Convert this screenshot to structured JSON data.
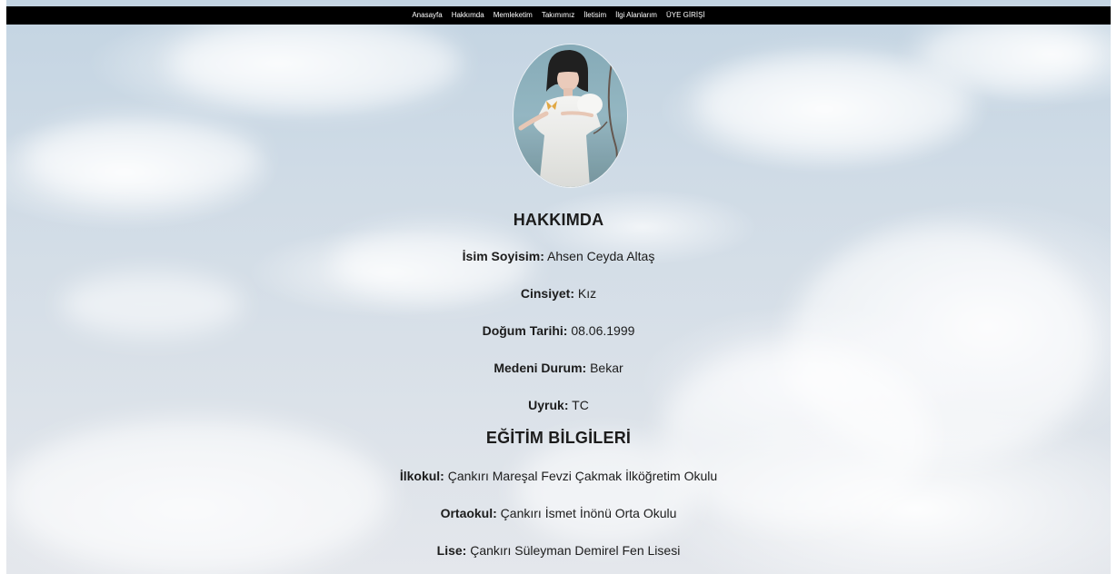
{
  "nav": {
    "items": [
      {
        "label": "Anasayfa"
      },
      {
        "label": "Hakkımda"
      },
      {
        "label": "Memleketim"
      },
      {
        "label": "Takımımız"
      },
      {
        "label": "İletisim"
      },
      {
        "label": "İlgi Alanlarım"
      },
      {
        "label": "ÜYE GİRİŞİ"
      }
    ]
  },
  "profile": {
    "photo_alt": "profile-photo"
  },
  "about": {
    "heading": "HAKKIMDA",
    "rows": [
      {
        "label": "İsim Soyisim:",
        "value": " Ahsen Ceyda Altaş"
      },
      {
        "label": "Cinsiyet:",
        "value": " Kız"
      },
      {
        "label": "Doğum Tarihi:",
        "value": " 08.06.1999"
      },
      {
        "label": "Medeni Durum:",
        "value": " Bekar"
      },
      {
        "label": "Uyruk:",
        "value": " TC"
      }
    ]
  },
  "education": {
    "heading": "EĞİTİM BİLGİLERİ",
    "rows": [
      {
        "label": "İlkokul:",
        "value": " Çankırı Mareşal Fevzi Çakmak İlköğretim Okulu"
      },
      {
        "label": "Ortaokul:",
        "value": " Çankırı İsmet İnönü Orta Okulu"
      },
      {
        "label": "Lise:",
        "value": " Çankırı Süleyman Demirel Fen Lisesi"
      }
    ]
  },
  "colors": {
    "nav_bg": "#000000",
    "nav_text": "#ffffff",
    "text": "#1c1c1c",
    "sky": "#cfdbe6"
  }
}
